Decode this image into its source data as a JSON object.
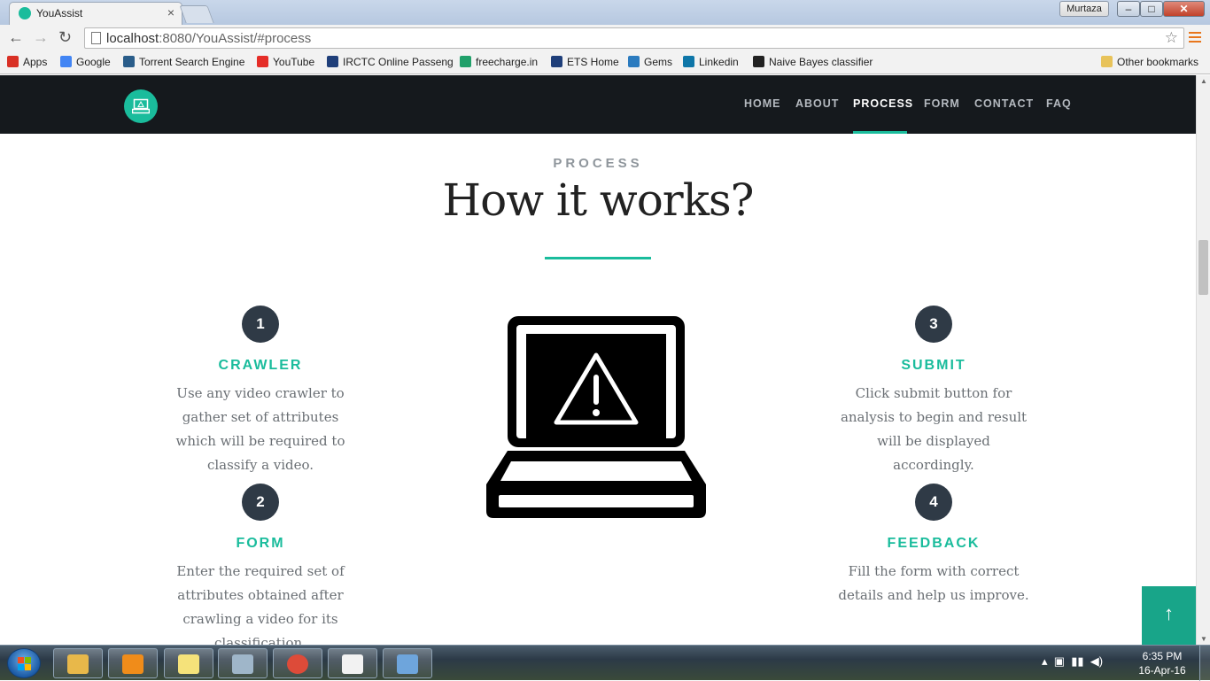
{
  "browser": {
    "tab_title": "YouAssist",
    "tab_close": "×",
    "user_name": "Murtaza",
    "win_min": "–",
    "win_max": "□",
    "win_close": "✕",
    "url_host": "localhost",
    "url_rest": ":8080/YouAssist/#process",
    "bookmarks": [
      {
        "label": "Apps",
        "icon": "apps-grid-icon",
        "color": "#d93025"
      },
      {
        "label": "Google",
        "icon": "google-icon",
        "color": "#4285f4"
      },
      {
        "label": "Torrent Search Engine",
        "icon": "torrent-icon",
        "color": "#2a5d8a"
      },
      {
        "label": "YouTube",
        "icon": "youtube-icon",
        "color": "#e52d27"
      },
      {
        "label": "IRCTC Online Passeng",
        "icon": "irctc-icon",
        "color": "#1f3f7a"
      },
      {
        "label": "freecharge.in",
        "icon": "freecharge-icon",
        "color": "#20a06a"
      },
      {
        "label": "ETS Home",
        "icon": "ets-icon",
        "color": "#1f3f7a"
      },
      {
        "label": "Gems",
        "icon": "gems-icon",
        "color": "#2b7bbf"
      },
      {
        "label": "Linkedin",
        "icon": "linkedin-icon",
        "color": "#0e76a8"
      },
      {
        "label": "Naive Bayes classifier",
        "icon": "wikipedia-icon",
        "color": "#222222"
      }
    ],
    "other_bookmarks": "Other bookmarks"
  },
  "site": {
    "nav": [
      {
        "label": "HOME",
        "active": false
      },
      {
        "label": "ABOUT",
        "active": false
      },
      {
        "label": "PROCESS",
        "active": true
      },
      {
        "label": "FORM",
        "active": false
      },
      {
        "label": "CONTACT",
        "active": false
      },
      {
        "label": "FAQ",
        "active": false
      }
    ],
    "accent_color": "#1abc9c",
    "section_label": "PROCESS",
    "section_title": "How it works?",
    "steps": [
      {
        "number": "1",
        "title": "CRAWLER",
        "desc": "Use any video crawler to gather set of attributes which will be required to classify a video."
      },
      {
        "number": "2",
        "title": "FORM",
        "desc": "Enter the required set of attributes obtained after crawling a video for its classification."
      },
      {
        "number": "3",
        "title": "SUBMIT",
        "desc": "Click submit button for analysis to begin and result will be displayed accordingly."
      },
      {
        "number": "4",
        "title": "FEEDBACK",
        "desc": "Fill the form with correct details and help us improve."
      }
    ],
    "back_to_top_icon": "arrow-up-icon",
    "back_to_top": "↑"
  },
  "taskbar": {
    "time": "6:35 PM",
    "date": "16-Apr-16",
    "tray": "▴",
    "apps": [
      {
        "name": "explorer-icon",
        "color": "#e8b84a"
      },
      {
        "name": "media-player-icon",
        "color": "#f08c1a"
      },
      {
        "name": "sticky-notes-icon",
        "color": "#f5e27a"
      },
      {
        "name": "calculator-icon",
        "color": "#9fb6c9"
      },
      {
        "name": "chrome-icon",
        "color": "#dd4b39"
      },
      {
        "name": "tex-icon",
        "color": "#f2f2f2"
      },
      {
        "name": "virtualbox-icon",
        "color": "#6ea5dc"
      }
    ]
  }
}
